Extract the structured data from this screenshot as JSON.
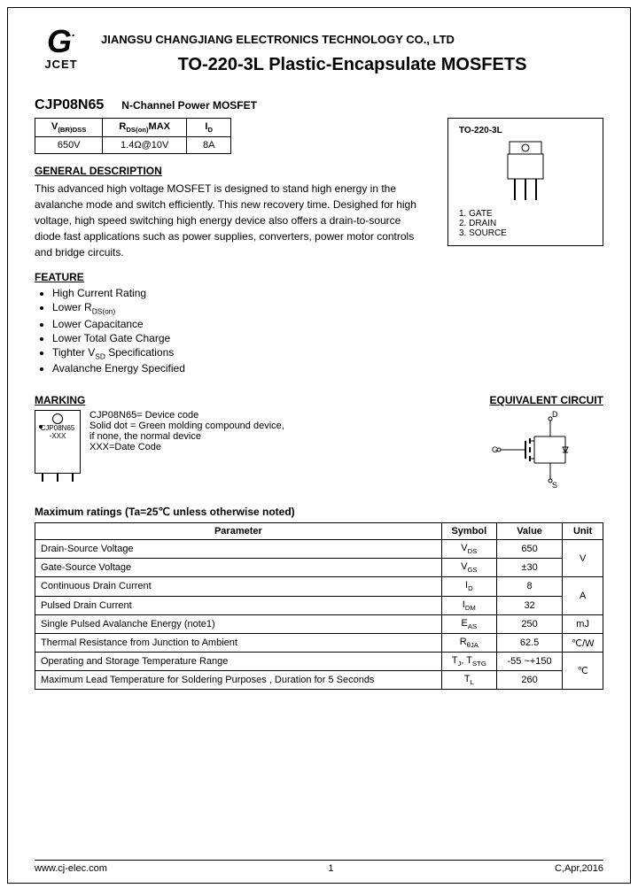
{
  "logo": {
    "brand": "JCET"
  },
  "company": "JIANGSU CHANGJIANG ELECTRONICS TECHNOLOGY CO., LTD",
  "title": "TO-220-3L Plastic-Encapsulate MOSFETS",
  "part": {
    "number": "CJP08N65",
    "desc": "N-Channel Power MOSFET"
  },
  "spec": {
    "h1": "V(BR)DSS",
    "h2": "RDS(on)MAX",
    "h3": "ID",
    "v1": "650V",
    "v2": "1.4Ω@10V",
    "v3": "8A"
  },
  "package": {
    "name": "TO-220-3L",
    "pins": {
      "p1": "1. GATE",
      "p2": "2. DRAIN",
      "p3": "3. SOURCE"
    }
  },
  "sections": {
    "general_title": "GENERAL DESCRIPTION",
    "general_text": "This advanced high voltage MOSFET is designed to stand high energy in the avalanche mode and switch efficiently. This new recovery time. Desighed for high voltage, high speed switching high energy device also offers a drain-to-source diode fast applications such as power supplies, converters, power motor controls and bridge circuits.",
    "feature_title": "FEATURE",
    "features": {
      "f1": "High Current Rating",
      "f2": "Lower RDS(on)",
      "f3": "Lower Capacitance",
      "f4": "Lower Total Gate Charge",
      "f5": "Tighter VSD Specifications",
      "f6": "Avalanche Energy Specified"
    },
    "marking_title": "MARKING",
    "marking_text": "CJP08N65= Device code\nSolid dot = Green molding compound device,\nif none, the normal device\nXXX=Date Code",
    "marking_code": "CJP08N65",
    "marking_date": "-XXX",
    "circuit_title": "EQUIVALENT CIRCUIT",
    "circuit_labels": {
      "g": "G",
      "d": "D",
      "s": "S"
    }
  },
  "ratings": {
    "title": "Maximum ratings (Ta=25℃ unless otherwise noted)",
    "headers": {
      "param": "Parameter",
      "symbol": "Symbol",
      "value": "Value",
      "unit": "Unit"
    },
    "rows": {
      "r1": {
        "p": "Drain-Source Voltage",
        "s": "VDS",
        "v": "650",
        "u": "V"
      },
      "r2": {
        "p": "Gate-Source Voltage",
        "s": "VGS",
        "v": "±30"
      },
      "r3": {
        "p": "Continuous Drain Current",
        "s": "ID",
        "v": "8",
        "u": "A"
      },
      "r4": {
        "p": "Pulsed Drain Current",
        "s": "IDM",
        "v": "32"
      },
      "r5": {
        "p": "Single Pulsed Avalanche Energy (note1)",
        "s": "EAS",
        "v": "250",
        "u": "mJ"
      },
      "r6": {
        "p": "Thermal Resistance from Junction to Ambient",
        "s": "RθJA",
        "v": "62.5",
        "u": "℃/W"
      },
      "r7": {
        "p": "Operating and Storage Temperature Range",
        "s": "TJ, TSTG",
        "v": "-55 ~+150",
        "u": "℃"
      },
      "r8": {
        "p": "Maximum Lead Temperature for Soldering Purposes , Duration for 5 Seconds",
        "s": "TL",
        "v": "260"
      }
    }
  },
  "footer": {
    "url": "www.cj-elec.com",
    "page": "1",
    "date": "C,Apr,2016"
  }
}
